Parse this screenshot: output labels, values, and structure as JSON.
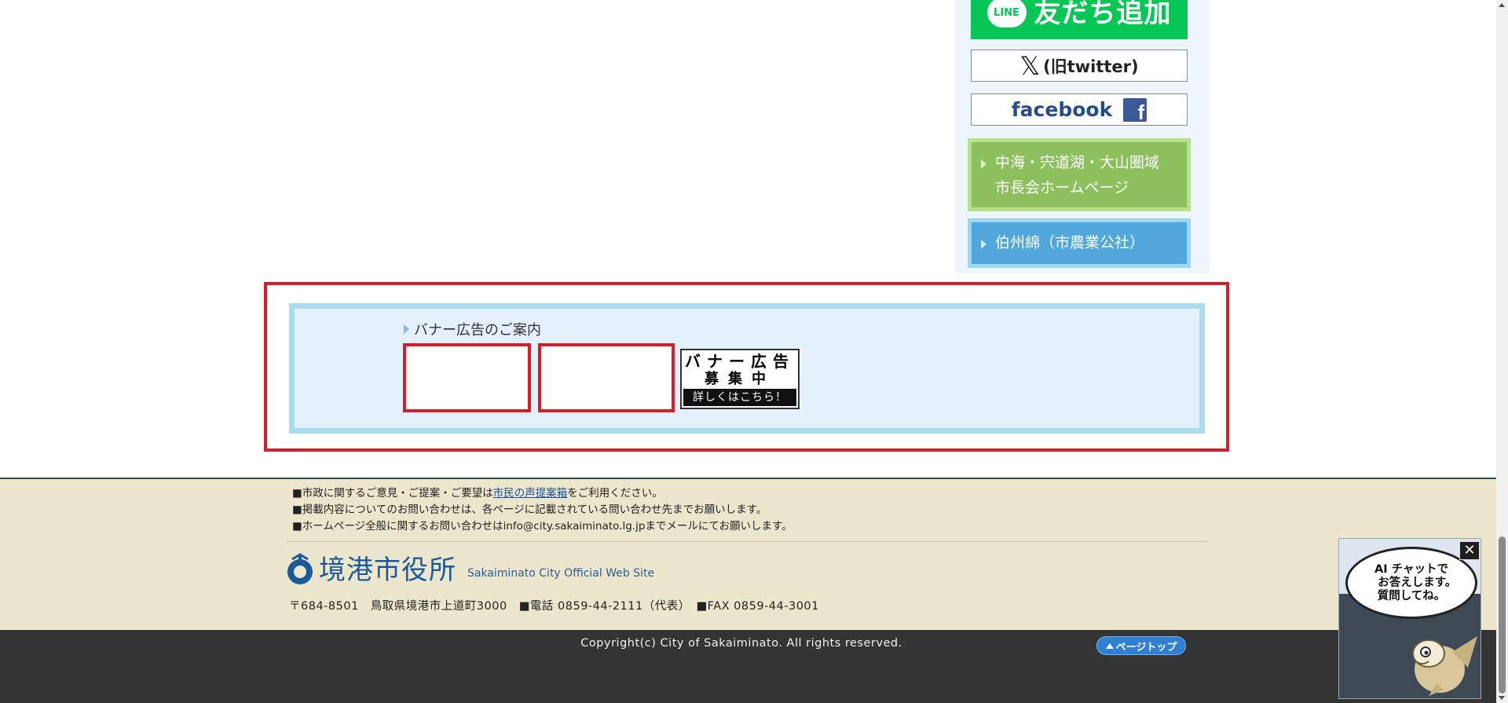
{
  "sidebar": {
    "line_badge": "LINE",
    "line_label": "友だち追加",
    "x_label": "(旧twitter)",
    "facebook_label": "facebook",
    "links": [
      {
        "label": "中海・宍道湖・大山圏域\n市長会ホームページ",
        "color": "#8cc05d"
      },
      {
        "label": "伯州綿（市農業公社）",
        "color": "#4fa7dc"
      }
    ]
  },
  "banner": {
    "heading": "バナー広告のご案内",
    "recruit_line1": "バナー広告",
    "recruit_line2": "募集中",
    "recruit_line3": "詳しくはこちら！"
  },
  "footer": {
    "note1_prefix": "■市政に関するご意見・ご提案・ご要望は",
    "note1_link": "市民の声提案箱",
    "note1_suffix": "をご利用ください。",
    "note2": "■掲載内容についてのお問い合わせは、各ページに記載されている問い合わせ先までお願いします。",
    "note3": "■ホームページ全般に関するお問い合わせはinfo@city.sakaiminato.lg.jpまでメールにてお願いします。",
    "city_name": "境港市役所",
    "tagline": "Sakaiminato City Official Web Site",
    "address": "〒684-8501　鳥取県境港市上道町3000　■電話 0859-44-2111（代表）　■FAX 0859-44-3001",
    "copyright": "Copyright(c) City of Sakaiminato. All rights reserved.",
    "pagetop_label": "ページトップ"
  },
  "ai_chat": {
    "bubble_text": "AI チャットで\n　お答えします。\n質問してね。",
    "close_label": "✕"
  },
  "colors": {
    "accent_red": "#d61e2b",
    "line_green": "#06c755",
    "footer_bg": "#ece6cd",
    "footer_dark": "#343434"
  }
}
